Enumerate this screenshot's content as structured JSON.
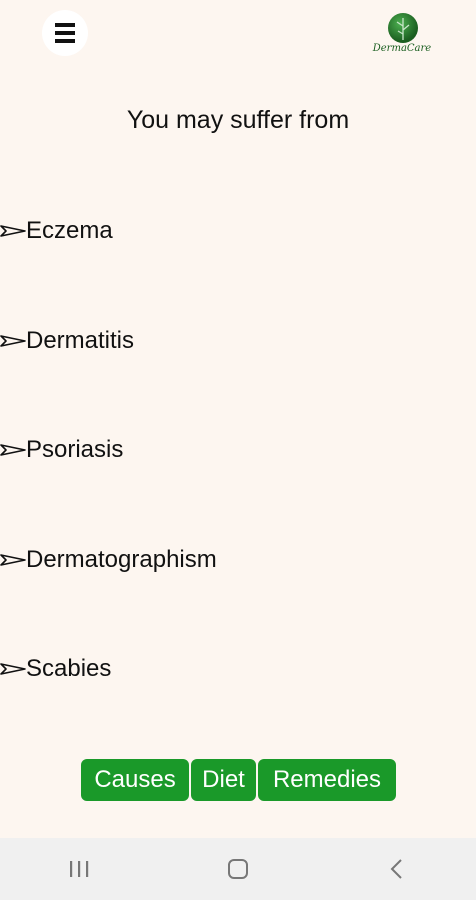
{
  "header": {
    "menu_icon": "hamburger-menu-icon",
    "logo_text": "DermaCare"
  },
  "heading": "You may suffer from",
  "diseases": [
    {
      "label": "Eczema",
      "icon": "arrow-icon"
    },
    {
      "label": "Dermatitis",
      "icon": "arrow-icon"
    },
    {
      "label": "Psoriasis",
      "icon": "arrow-icon"
    },
    {
      "label": "Dermatographism",
      "icon": "arrow-icon"
    },
    {
      "label": "Scabies",
      "icon": "arrow-icon"
    }
  ],
  "buttons": {
    "causes": "Causes",
    "diet": "Diet",
    "remedies": "Remedies"
  },
  "colors": {
    "background": "#fdf6f0",
    "button_green": "#1a9929",
    "navbar": "#f0f0f0"
  },
  "navbar": {
    "recents_icon": "recent-apps-icon",
    "home_icon": "home-icon",
    "back_icon": "back-icon"
  }
}
